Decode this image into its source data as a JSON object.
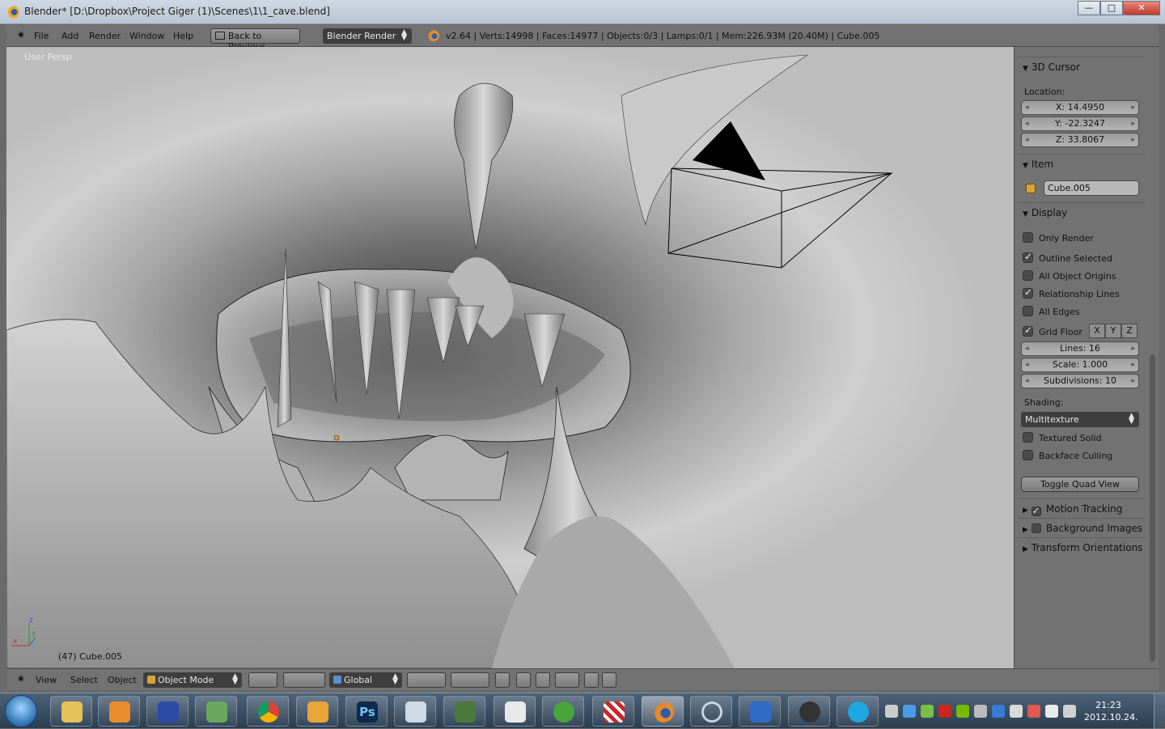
{
  "window": {
    "title": "Blender* [D:\\Dropbox\\Project Giger (1)\\Scenes\\1\\1_cave.blend]",
    "min": "—",
    "max": "□",
    "close": "✕"
  },
  "menubar": {
    "file": "File",
    "add": "Add",
    "render": "Render",
    "window": "Window",
    "help": "Help",
    "back_to_previous": "Back to Previous",
    "render_engine": "Blender Render",
    "stats": "v2.64 | Verts:14998 | Faces:14977 | Objects:0/3 | Lamps:0/1 | Mem:226.93M (20.40M) | Cube.005"
  },
  "viewport": {
    "view_label": "User Persp",
    "active_object": "(47) Cube.005",
    "axis_x": "x",
    "axis_y": "y",
    "axis_z": "z"
  },
  "npanel": {
    "cursor_section": "3D Cursor",
    "location_label": "Location:",
    "cursor_x": "X: 14.4950",
    "cursor_y": "Y: -22.3247",
    "cursor_z": "Z: 33.8067",
    "item_section": "Item",
    "item_name": "Cube.005",
    "display_section": "Display",
    "only_render": {
      "label": "Only Render",
      "checked": false
    },
    "outline_selected": {
      "label": "Outline Selected",
      "checked": true
    },
    "all_object_origins": {
      "label": "All Object Origins",
      "checked": false
    },
    "relationship_lines": {
      "label": "Relationship Lines",
      "checked": true
    },
    "all_edges": {
      "label": "All Edges",
      "checked": false
    },
    "grid_floor": {
      "label": "Grid Floor",
      "checked": true
    },
    "axis_x": "X",
    "axis_y": "Y",
    "axis_z": "Z",
    "lines": "Lines: 16",
    "scale": "Scale: 1.000",
    "subdivisions": "Subdivisions: 10",
    "shading_label": "Shading:",
    "shading_value": "Multitexture",
    "textured_solid": {
      "label": "Textured Solid",
      "checked": false
    },
    "backface_culling": {
      "label": "Backface Culling",
      "checked": false
    },
    "toggle_quad_view": "Toggle Quad View",
    "motion_tracking": "Motion Tracking",
    "background_images": "Background Images",
    "transform_orientations": "Transform Orientations"
  },
  "bottombar": {
    "view": "View",
    "select": "Select",
    "object": "Object",
    "mode": "Object Mode",
    "orientation": "Global"
  },
  "taskbar": {
    "time": "21:23",
    "date": "2012.10.24.",
    "ps_label": "Ps"
  }
}
